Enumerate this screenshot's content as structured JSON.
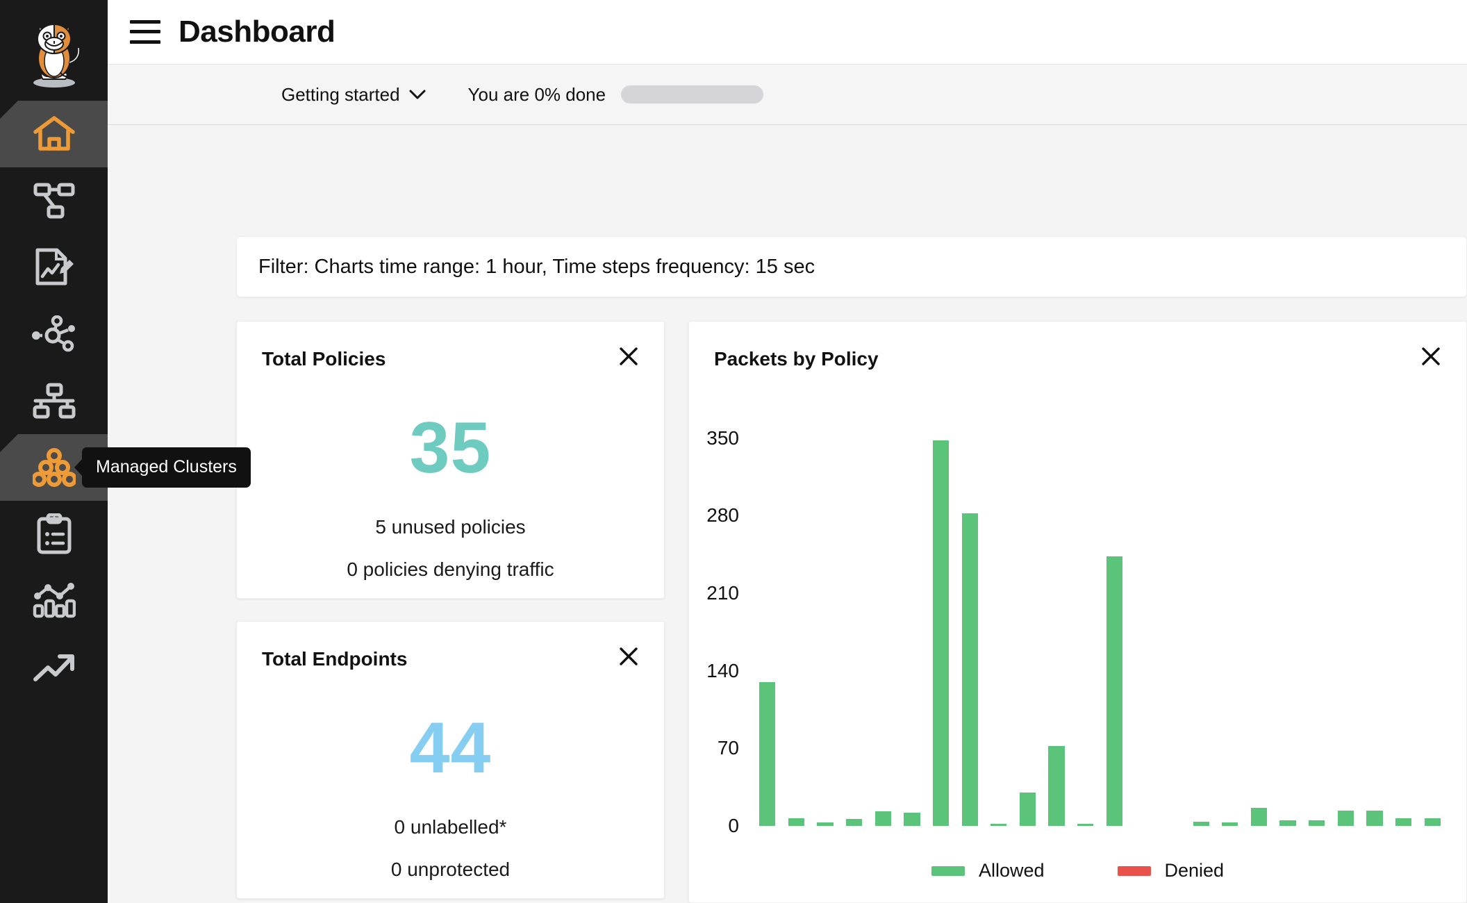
{
  "header": {
    "title": "Dashboard",
    "menu_icon": "hamburger-icon"
  },
  "getting_started": {
    "label": "Getting started",
    "chevron_icon": "chevron-down-icon",
    "progress_text": "You are 0% done",
    "progress_percent": 0
  },
  "sidebar": {
    "logo": "cat-logo",
    "items": [
      {
        "name": "dashboard",
        "icon": "home-icon",
        "active": true
      },
      {
        "name": "policies",
        "icon": "policy-graph-icon",
        "active": false
      },
      {
        "name": "policies-board",
        "icon": "document-edit-icon",
        "active": false
      },
      {
        "name": "service-graph",
        "icon": "network-nodes-icon",
        "active": false
      },
      {
        "name": "nodes",
        "icon": "hierarchy-icon",
        "active": false
      },
      {
        "name": "managed-clusters",
        "icon": "clusters-icon",
        "active": true,
        "tooltip": "Managed Clusters"
      },
      {
        "name": "compliance-reports",
        "icon": "clipboard-list-icon",
        "active": false
      },
      {
        "name": "kibana",
        "icon": "bar-chart-icon",
        "active": false
      },
      {
        "name": "timeline",
        "icon": "trending-up-icon",
        "active": false
      }
    ]
  },
  "filter": {
    "text": "Filter: Charts time range: 1 hour, Time steps frequency: 15 sec"
  },
  "cards": {
    "total_policies": {
      "title": "Total Policies",
      "close_icon": "close-icon",
      "value": "35",
      "value_color": "#6ECBC0",
      "lines": [
        "5 unused policies",
        "0 policies denying traffic"
      ]
    },
    "total_endpoints": {
      "title": "Total Endpoints",
      "close_icon": "close-icon",
      "value": "44",
      "value_color": "#85CEF2",
      "lines": [
        "0 unlabelled*",
        "0 unprotected"
      ]
    },
    "packets_by_policy": {
      "title": "Packets by Policy",
      "close_icon": "close-icon"
    }
  },
  "chart_data": {
    "type": "bar",
    "title": "Packets by Policy",
    "xlabel": "",
    "ylabel": "",
    "ylim": [
      0,
      380
    ],
    "yticks": [
      0,
      70,
      140,
      210,
      280,
      350
    ],
    "grid": false,
    "legend_position": "bottom",
    "colors": {
      "allowed": "#5BC47A",
      "denied": "#E8524A"
    },
    "series": [
      {
        "name": "Allowed",
        "color": "#5BC47A",
        "values": [
          130,
          7,
          3,
          6,
          13,
          12,
          348,
          282,
          2,
          30,
          72,
          1,
          243,
          0,
          0,
          4,
          3,
          16,
          5,
          5,
          14,
          14,
          7,
          7
        ]
      },
      {
        "name": "Denied",
        "color": "#E8524A",
        "values": [
          0,
          0,
          0,
          0,
          0,
          0,
          0,
          0,
          0,
          0,
          0,
          0,
          0,
          0,
          0,
          0,
          0,
          0,
          0,
          0,
          0,
          0,
          0,
          0
        ]
      }
    ],
    "legend": [
      "Allowed",
      "Denied"
    ]
  }
}
